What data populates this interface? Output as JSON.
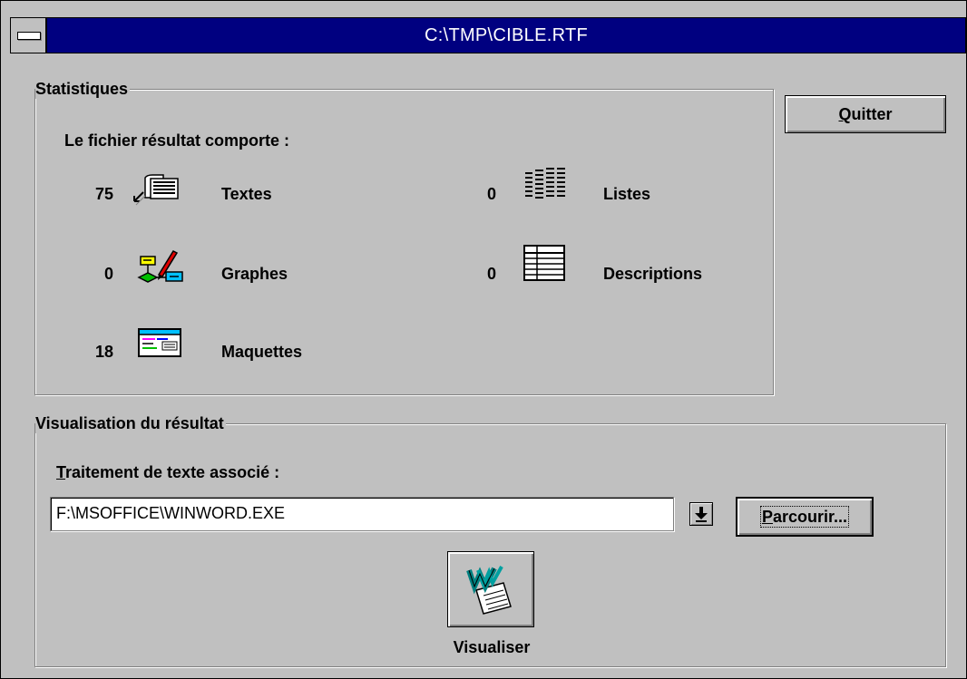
{
  "window": {
    "title": "C:\\TMP\\CIBLE.RTF"
  },
  "statistiques": {
    "group_label": "Statistiques",
    "intro": "Le fichier résultat comporte :",
    "items": [
      {
        "count": "75",
        "label": "Textes",
        "icon": "textes-icon"
      },
      {
        "count": "0",
        "label": "Listes",
        "icon": "listes-icon"
      },
      {
        "count": "0",
        "label": "Graphes",
        "icon": "graphes-icon"
      },
      {
        "count": "0",
        "label": "Descriptions",
        "icon": "descriptions-icon"
      },
      {
        "count": "18",
        "label": "Maquettes",
        "icon": "maquettes-icon"
      }
    ]
  },
  "buttons": {
    "quitter_prefix": "Q",
    "quitter_rest": "uitter",
    "parcourir_prefix": "P",
    "parcourir_rest": "arcourir...",
    "visualiser_label": "Visualiser"
  },
  "visualisation": {
    "group_label": "Visualisation du résultat",
    "field_label_prefix": "T",
    "field_label_rest": "raitement de texte associé :",
    "editor_path": "F:\\MSOFFICE\\WINWORD.EXE"
  },
  "colors": {
    "titlebar": "#000080",
    "face": "#c0c0c0"
  }
}
